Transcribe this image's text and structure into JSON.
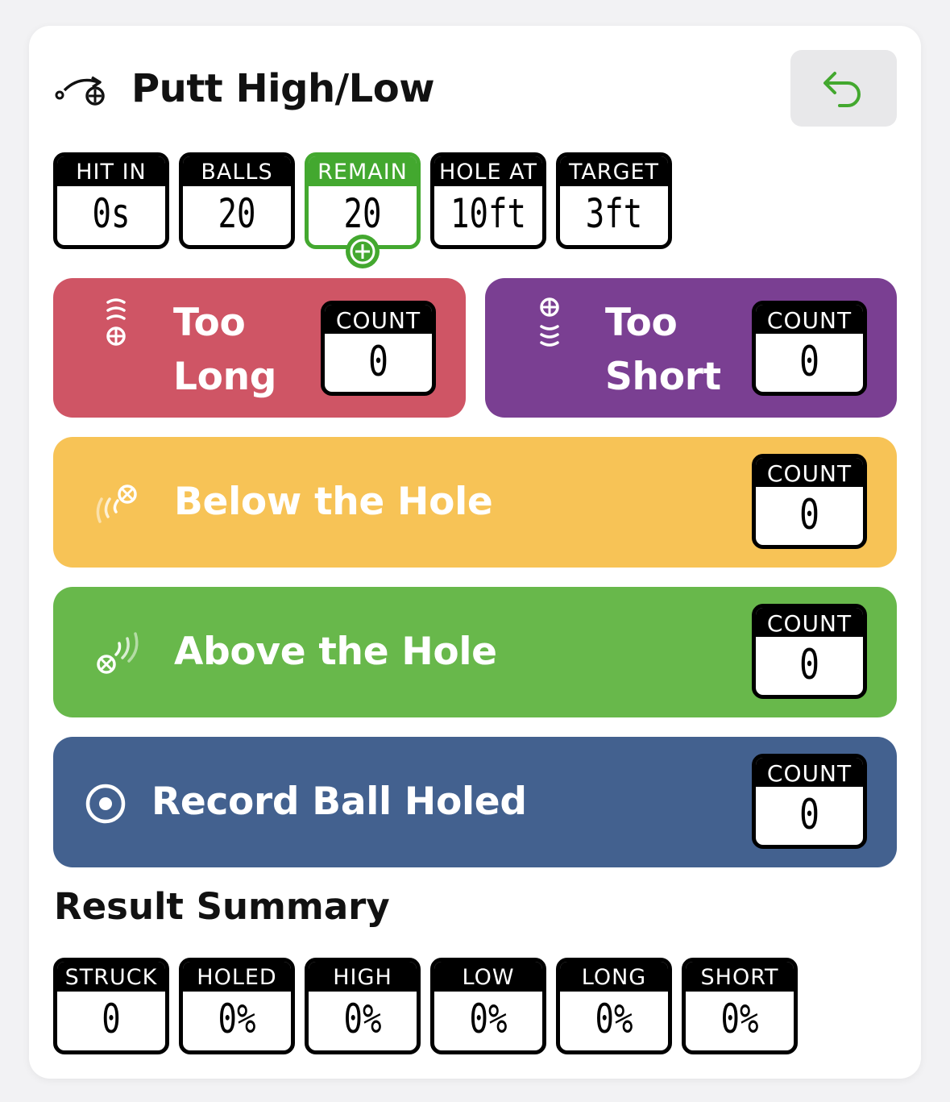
{
  "header": {
    "title": "Putt High/Low",
    "drill_icon": "putt-path-icon",
    "undo_icon": "undo-arrow-icon"
  },
  "stats": [
    {
      "label": "HIT IN",
      "value": "0s"
    },
    {
      "label": "BALLS",
      "value": "20"
    },
    {
      "label": "REMAIN",
      "value": "20"
    },
    {
      "label": "HOLE AT",
      "value": "10ft"
    },
    {
      "label": "TARGET",
      "value": "3ft"
    }
  ],
  "buttons": {
    "too_long": {
      "line1": "Too",
      "line2": "Long",
      "count_label": "COUNT",
      "count": "0",
      "color": "#cf5565"
    },
    "too_short": {
      "line1": "Too",
      "line2": "Short",
      "count_label": "COUNT",
      "count": "0",
      "color": "#7a3f92"
    },
    "below": {
      "label": "Below the Hole",
      "count_label": "COUNT",
      "count": "0",
      "color": "#f7c356"
    },
    "above": {
      "label": "Above the Hole",
      "count_label": "COUNT",
      "count": "0",
      "color": "#68b84b"
    },
    "holed": {
      "label": "Record Ball Holed",
      "count_label": "COUNT",
      "count": "0",
      "color": "#43618f"
    }
  },
  "summary": {
    "title": "Result Summary",
    "items": [
      {
        "label": "STRUCK",
        "value": "0"
      },
      {
        "label": "HOLED",
        "value": "0%"
      },
      {
        "label": "HIGH",
        "value": "0%"
      },
      {
        "label": "LOW",
        "value": "0%"
      },
      {
        "label": "LONG",
        "value": "0%"
      },
      {
        "label": "SHORT",
        "value": "0%"
      }
    ]
  },
  "colors": {
    "accent_green": "#43a82f"
  }
}
